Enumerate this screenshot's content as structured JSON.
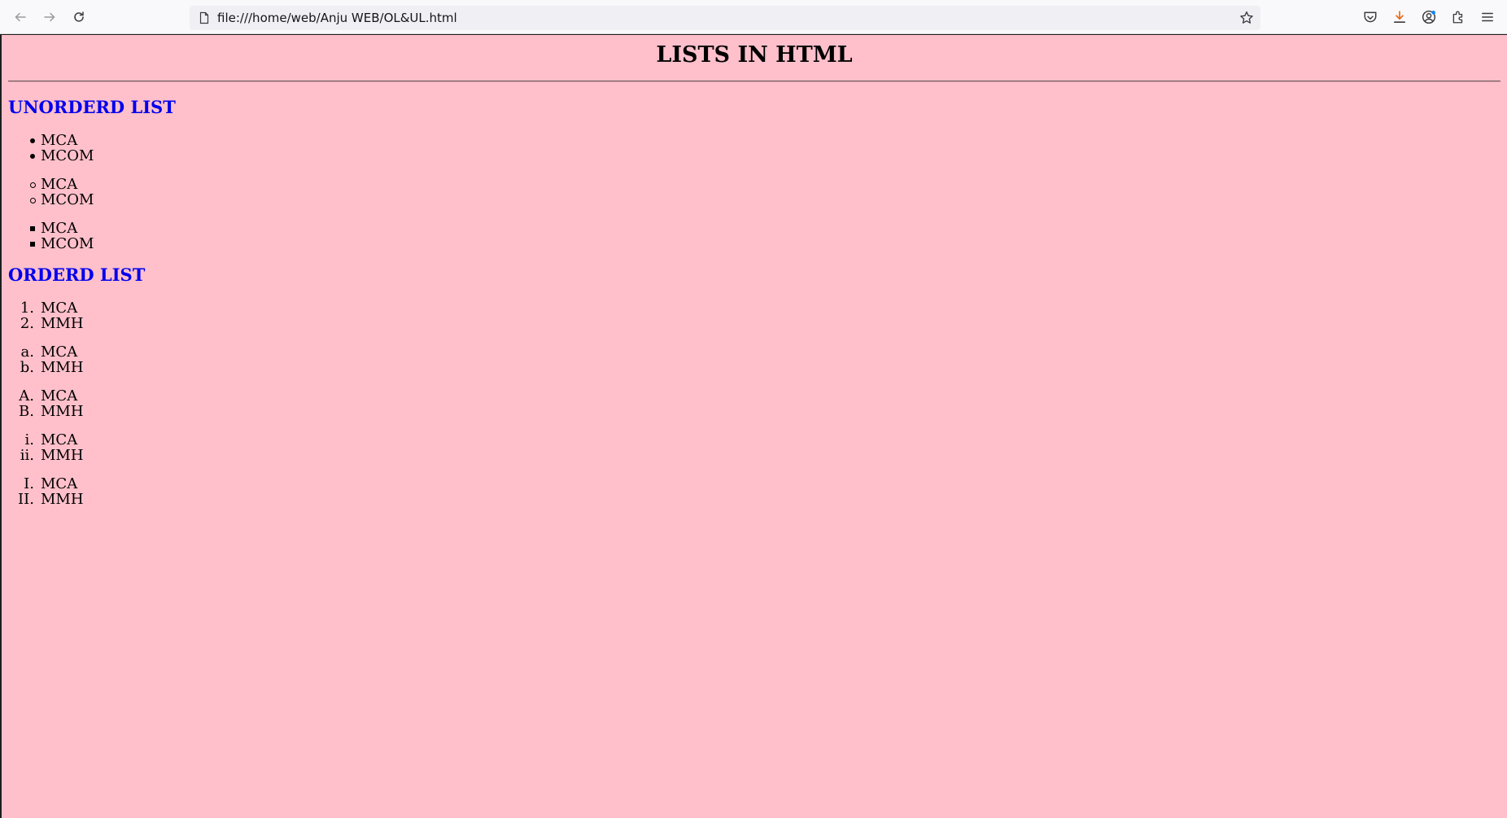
{
  "browser": {
    "url": "file:///home/web/Anju WEB/OL&UL.html",
    "icons": [
      "back-icon",
      "forward-icon",
      "reload-icon",
      "page-icon",
      "bookmark-star-icon",
      "pocket-icon",
      "downloads-icon",
      "account-icon",
      "extensions-icon",
      "menu-icon"
    ]
  },
  "page": {
    "background": "#ffc0cb",
    "heading_color": "#0000ee",
    "title": "LISTS IN HTML",
    "unordered_heading": "UNORDERD LIST",
    "unordered_lists": [
      {
        "style": "disc",
        "items": [
          "MCA",
          "MCOM"
        ]
      },
      {
        "style": "circle",
        "items": [
          "MCA",
          "MCOM"
        ]
      },
      {
        "style": "square",
        "items": [
          "MCA",
          "MCOM"
        ]
      }
    ],
    "ordered_heading": "ORDERD LIST",
    "ordered_lists": [
      {
        "markers": [
          "1.",
          "2."
        ],
        "items": [
          "MCA",
          "MMH"
        ]
      },
      {
        "markers": [
          "a.",
          "b."
        ],
        "items": [
          "MCA",
          "MMH"
        ]
      },
      {
        "markers": [
          "A.",
          "B."
        ],
        "items": [
          "MCA",
          "MMH"
        ]
      },
      {
        "markers": [
          "i.",
          "ii."
        ],
        "items": [
          "MCA",
          "MMH"
        ]
      },
      {
        "markers": [
          "I.",
          "II."
        ],
        "items": [
          "MCA",
          "MMH"
        ]
      }
    ]
  }
}
